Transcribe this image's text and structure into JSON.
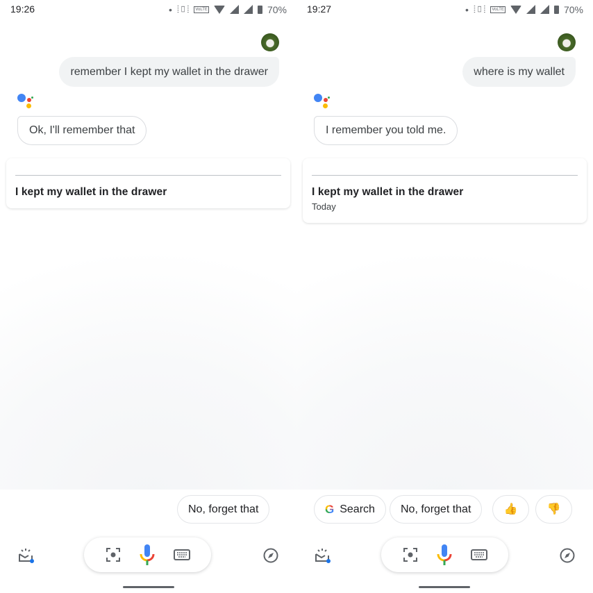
{
  "panels": [
    {
      "status": {
        "time": "19:26",
        "battery": "70%",
        "volte": "VoLTE"
      },
      "user_query": "remember I kept my wallet in the drawer",
      "assistant_reply": "Ok, I'll remember that",
      "card": {
        "title": "I kept my wallet in the drawer"
      },
      "chips": [
        {
          "label": "No, forget that"
        }
      ]
    },
    {
      "status": {
        "time": "19:27",
        "battery": "70%",
        "volte": "VoLTE"
      },
      "user_query": "where is my wallet",
      "assistant_reply": "I remember you told me.",
      "card": {
        "title": "I kept my wallet in the drawer",
        "subtitle": "Today"
      },
      "chips": [
        {
          "label": "Search",
          "icon": "google-g-icon"
        },
        {
          "label": "No, forget that"
        },
        {
          "label": "👍",
          "icon": "thumbs-up-icon"
        },
        {
          "label": "👎",
          "icon": "thumbs-down-icon"
        }
      ]
    }
  ],
  "colors": {
    "blue": "#4285f4",
    "red": "#ea4335",
    "yellow": "#fbbc05",
    "green": "#34a853",
    "bubble": "#f1f3f4"
  }
}
